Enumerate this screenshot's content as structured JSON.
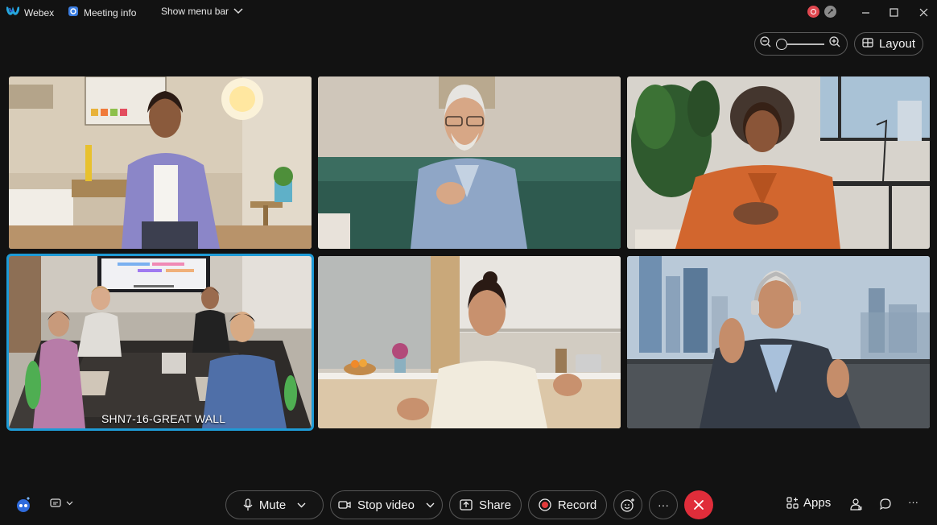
{
  "titlebar": {
    "app_name": "Webex",
    "meeting_info": "Meeting info",
    "show_menu_bar": "Show menu bar"
  },
  "view_controls": {
    "layout_label": "Layout"
  },
  "participants": [
    {
      "name": "",
      "active": false
    },
    {
      "name": "",
      "active": false
    },
    {
      "name": "",
      "active": false
    },
    {
      "name": "SHN7-16-GREAT WALL",
      "active": true
    },
    {
      "name": "",
      "active": false
    },
    {
      "name": "",
      "active": false
    }
  ],
  "controls": {
    "mute_label": "Mute",
    "stop_video_label": "Stop video",
    "share_label": "Share",
    "record_label": "Record",
    "apps_label": "Apps",
    "more_glyph": "···"
  },
  "colors": {
    "accent": "#1e9bd6",
    "end_call": "#e02d3a",
    "record_dot": "#e23b3b",
    "background": "#121212"
  }
}
